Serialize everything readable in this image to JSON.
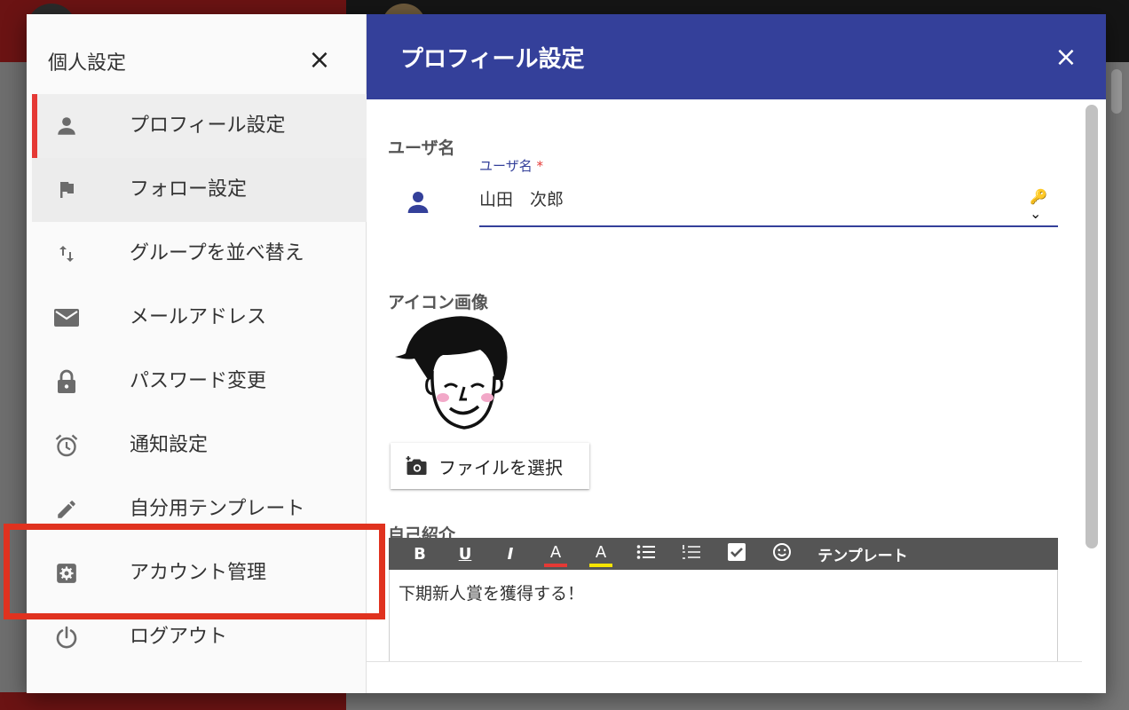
{
  "menu": {
    "title": "個人設定",
    "close_glyph": "×",
    "items": [
      {
        "label": "プロフィール設定",
        "icon": "person-icon"
      },
      {
        "label": "フォロー設定",
        "icon": "flag-icon"
      },
      {
        "label": "グループを並べ替え",
        "icon": "swap-vertical-icon"
      },
      {
        "label": "メールアドレス",
        "icon": "mail-icon"
      },
      {
        "label": "パスワード変更",
        "icon": "lock-icon"
      },
      {
        "label": "通知設定",
        "icon": "alarm-icon"
      },
      {
        "label": "自分用テンプレート",
        "icon": "pencil-icon"
      },
      {
        "label": "アカウント管理",
        "icon": "settings-box-icon"
      },
      {
        "label": "ログアウト",
        "icon": "power-icon"
      }
    ]
  },
  "panel": {
    "title": "プロフィール設定",
    "close_glyph": "×",
    "username_section": "ユーザ名",
    "username_field": {
      "label": "ユーザ名",
      "required_mark": "*",
      "value": "山田　次郎",
      "key_glyph": "🔑⌄"
    },
    "icon_section": "アイコン画像",
    "file_button": "ファイルを選択",
    "bio_section": "自己紹介",
    "toolbar": {
      "bold": "B",
      "underline": "U",
      "italic": "I",
      "text_color": "A",
      "highlight": "A",
      "template": "テンプレート"
    },
    "bio_text": "下期新人賞を獲得する！"
  },
  "colors": {
    "header": "#34409a",
    "active_bar": "#e53935",
    "highlight_box": "#e0321f",
    "toolbar": "#555555"
  }
}
